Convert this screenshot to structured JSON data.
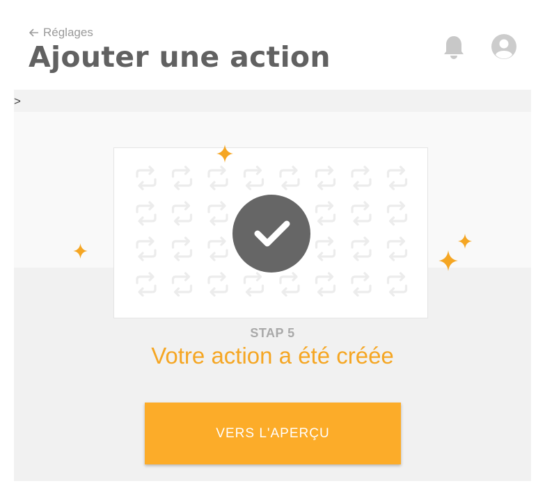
{
  "header": {
    "back_label": "Réglages",
    "title": "Ajouter une action"
  },
  "icons": {
    "back": "arrow-left-icon",
    "notifications": "bell-icon",
    "account": "user-avatar-icon"
  },
  "breadcrumb": {
    "text": ">"
  },
  "wizard": {
    "step_label": "STAP 5",
    "message": "Votre action a été créée",
    "cta_label": "VERS L'APERÇU"
  },
  "colors": {
    "accent": "#fcac29",
    "message": "#f5a623",
    "title": "#616161",
    "check_circle": "#666666"
  }
}
